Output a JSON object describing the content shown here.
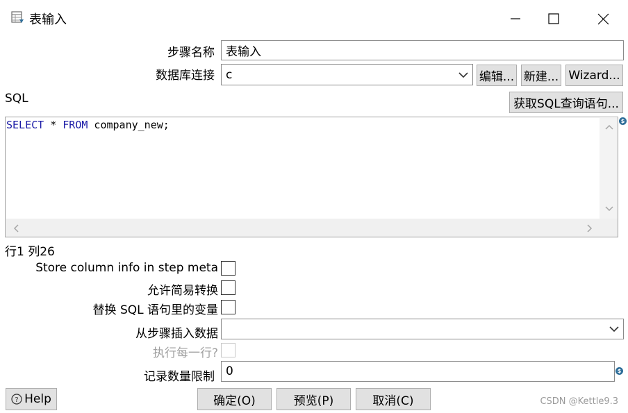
{
  "window": {
    "title": "表输入",
    "minimize": "—",
    "maximize": "☐",
    "close": "✕"
  },
  "step_name": {
    "label": "步骤名称",
    "value": "表输入"
  },
  "db_connection": {
    "label": "数据库连接",
    "value": "c",
    "edit_label": "编辑...",
    "new_label": "新建...",
    "wizard_label": "Wizard..."
  },
  "sql": {
    "label": "SQL",
    "get_sql_label": "获取SQL查询语句...",
    "kw1": "SELECT",
    "mid": " * ",
    "kw2": "FROM",
    "rest": " company_new;"
  },
  "cursor_position": "行1 列26",
  "options": {
    "store_column_info": "Store column info in step meta",
    "lazy_conversion": "允许简易转换",
    "replace_variables": "替换 SQL 语句里的变量",
    "insert_from_step": "从步骤插入数据",
    "insert_from_step_value": "",
    "execute_each_row": "执行每一行?",
    "limit_label": "记录数量限制",
    "limit_value": "0"
  },
  "footer": {
    "help": "Help",
    "ok": "确定(O)",
    "preview": "预览(P)",
    "cancel": "取消(C)",
    "watermark": "CSDN @Kettle9.3"
  },
  "icons": {
    "title": "table-input-icon",
    "help": "help-circle-icon",
    "variable": "variable-icon"
  }
}
